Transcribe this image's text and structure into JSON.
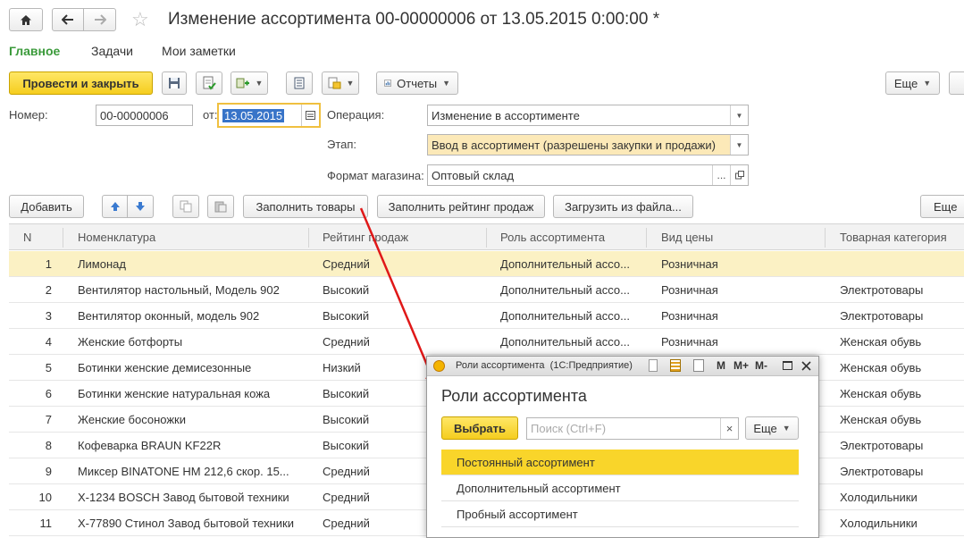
{
  "window": {
    "title": "Изменение ассортимента 00-00000006 от 13.05.2015 0:00:00 *"
  },
  "tabs": [
    "Главное",
    "Задачи",
    "Мои заметки"
  ],
  "toolbar": {
    "post_close": "Провести и закрыть",
    "reports": "Отчеты",
    "more": "Еще"
  },
  "form": {
    "number_label": "Номер:",
    "number_value": "00-00000006",
    "date_label": "от:",
    "date_value": "13.05.2015",
    "operation_label": "Операция:",
    "operation_value": "Изменение в ассортименте",
    "stage_label": "Этап:",
    "stage_value": "Ввод в ассортимент (разрешены закупки и продажи)",
    "format_label": "Формат магазина:",
    "format_value": "Оптовый склад",
    "format_select": "..."
  },
  "table_toolbar": {
    "add": "Добавить",
    "fill_goods": "Заполнить товары",
    "fill_rating": "Заполнить рейтинг продаж",
    "load_file": "Загрузить из файла...",
    "more": "Еще"
  },
  "table": {
    "columns": [
      "N",
      "Номенклатура",
      "Рейтинг продаж",
      "Роль ассортимента",
      "Вид цены",
      "Товарная категория"
    ],
    "rows": [
      [
        "1",
        "Лимонад",
        "Средний",
        "Дополнительный ассо...",
        "Розничная",
        ""
      ],
      [
        "2",
        "Вентилятор настольный, Модель 902",
        "Высокий",
        "Дополнительный ассо...",
        "Розничная",
        "Электротовары"
      ],
      [
        "3",
        "Вентилятор оконный, модель 902",
        "Высокий",
        "Дополнительный ассо...",
        "Розничная",
        "Электротовары"
      ],
      [
        "4",
        "Женские ботфорты",
        "Средний",
        "Дополнительный ассо...",
        "Розничная",
        "Женская обувь"
      ],
      [
        "5",
        "Ботинки женские демисезонные",
        "Низкий",
        "",
        "",
        "Женская обувь"
      ],
      [
        "6",
        "Ботинки женские натуральная кожа",
        "Высокий",
        "",
        "",
        "Женская обувь"
      ],
      [
        "7",
        "Женские босоножки",
        "Высокий",
        "",
        "",
        "Женская обувь"
      ],
      [
        "8",
        "Кофеварка BRAUN KF22R",
        "Высокий",
        "",
        "",
        "Электротовары"
      ],
      [
        "9",
        "Миксер BINATONE HM 212,6 скор. 15...",
        "Средний",
        "",
        "",
        "Электротовары"
      ],
      [
        "10",
        "X-1234 BOSCH Завод бытовой техники",
        "Средний",
        "",
        "",
        "Холодильники"
      ],
      [
        "11",
        "X-77890 Стинол Завод бытовой техники",
        "Средний",
        "",
        "",
        "Холодильники"
      ]
    ]
  },
  "popup": {
    "titlebar": "Роли ассортимента  (1С:Предприятие)",
    "tb_m": "M",
    "tb_mplus": "M+",
    "tb_mminus": "M-",
    "heading": "Роли ассортимента",
    "select": "Выбрать",
    "search_placeholder": "Поиск (Ctrl+F)",
    "clear": "×",
    "more": "Еще",
    "items": [
      "Постоянный ассортимент",
      "Дополнительный ассортимент",
      "Пробный ассортимент"
    ]
  },
  "colors": {
    "accent_yellow": "#f5cd1f",
    "selected_row": "#fbf1c4",
    "tab_active": "#3a9a3a",
    "arrow": "#e01818"
  }
}
